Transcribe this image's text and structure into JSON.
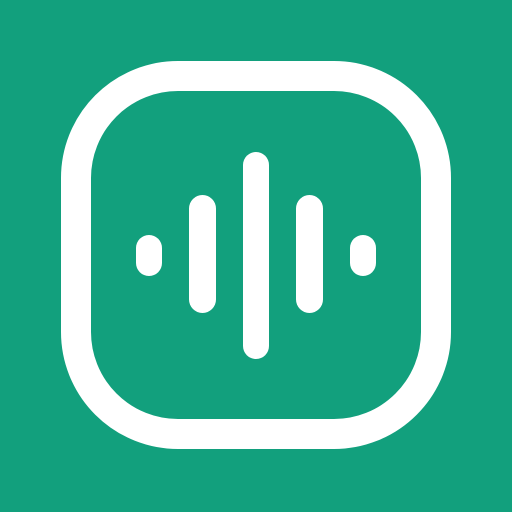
{
  "icon": {
    "name": "audio-waveform-icon",
    "background_color": "#12a07d",
    "foreground_color": "#ffffff",
    "frame_shape": "rounded-square-outline",
    "waveform_bars": 5
  }
}
